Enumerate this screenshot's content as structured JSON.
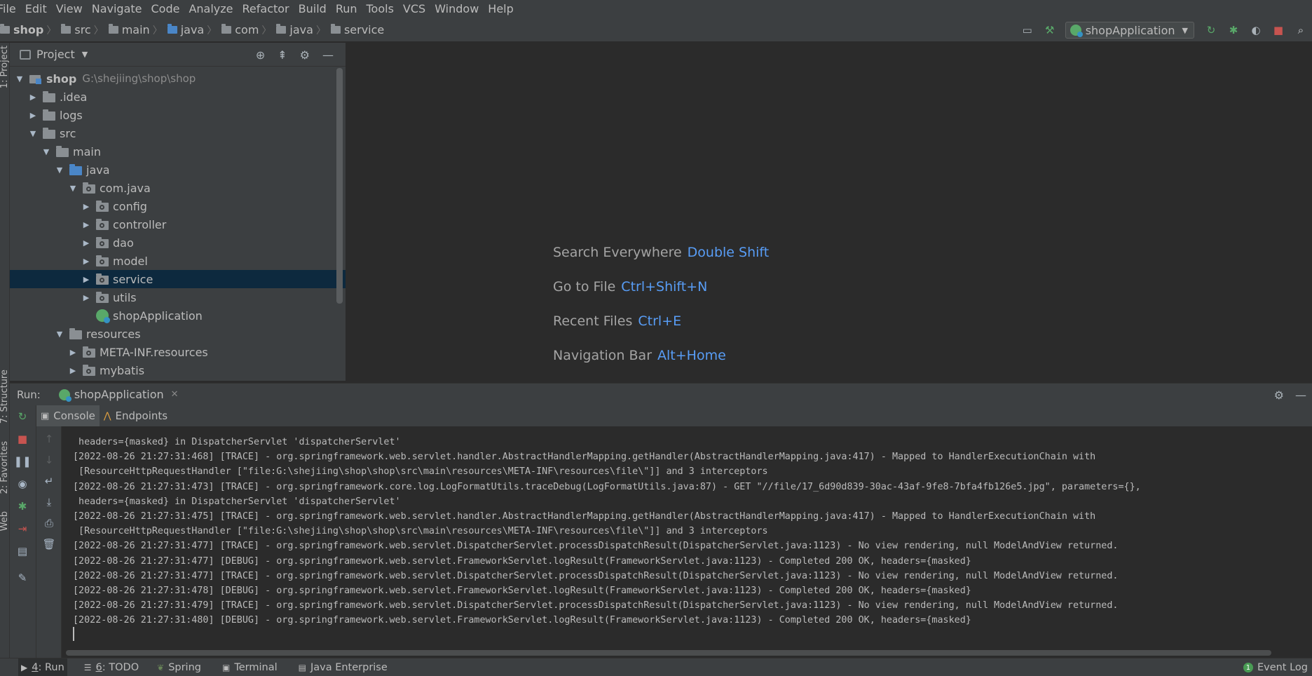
{
  "menu": [
    "File",
    "Edit",
    "View",
    "Navigate",
    "Code",
    "Analyze",
    "Refactor",
    "Build",
    "Run",
    "Tools",
    "VCS",
    "Window",
    "Help"
  ],
  "breadcrumb": [
    "shop",
    "src",
    "main",
    "java",
    "com",
    "java",
    "service"
  ],
  "run_config": "shopApplication",
  "project_panel": {
    "title": "Project",
    "stripe_labels": [
      "1: Project",
      "7: Structure",
      "2: Favorites",
      "Web"
    ],
    "tree": [
      {
        "label": "shop",
        "path": "G:\\shejiing\\shop\\shop",
        "depth": 0,
        "arrow": "open",
        "icon": "module",
        "bold": true
      },
      {
        "label": ".idea",
        "depth": 1,
        "arrow": "closed",
        "icon": "folder"
      },
      {
        "label": "logs",
        "depth": 1,
        "arrow": "closed",
        "icon": "folder"
      },
      {
        "label": "src",
        "depth": 1,
        "arrow": "open",
        "icon": "folder"
      },
      {
        "label": "main",
        "depth": 2,
        "arrow": "open",
        "icon": "folder"
      },
      {
        "label": "java",
        "depth": 3,
        "arrow": "open",
        "icon": "folder-blue"
      },
      {
        "label": "com.java",
        "depth": 4,
        "arrow": "open",
        "icon": "package"
      },
      {
        "label": "config",
        "depth": 5,
        "arrow": "closed",
        "icon": "package"
      },
      {
        "label": "controller",
        "depth": 5,
        "arrow": "closed",
        "icon": "package"
      },
      {
        "label": "dao",
        "depth": 5,
        "arrow": "closed",
        "icon": "package"
      },
      {
        "label": "model",
        "depth": 5,
        "arrow": "closed",
        "icon": "package"
      },
      {
        "label": "service",
        "depth": 5,
        "arrow": "closed",
        "icon": "package",
        "selected": true
      },
      {
        "label": "utils",
        "depth": 5,
        "arrow": "closed",
        "icon": "package"
      },
      {
        "label": "shopApplication",
        "depth": 5,
        "arrow": "none",
        "icon": "spring-app"
      },
      {
        "label": "resources",
        "depth": 3,
        "arrow": "open",
        "icon": "folder"
      },
      {
        "label": "META-INF.resources",
        "depth": 4,
        "arrow": "closed",
        "icon": "package"
      },
      {
        "label": "mybatis",
        "depth": 4,
        "arrow": "closed",
        "icon": "package"
      }
    ]
  },
  "editor_hints": [
    {
      "label": "Search Everywhere",
      "key": "Double Shift"
    },
    {
      "label": "Go to File",
      "key": "Ctrl+Shift+N"
    },
    {
      "label": "Recent Files",
      "key": "Ctrl+E"
    },
    {
      "label": "Navigation Bar",
      "key": "Alt+Home"
    }
  ],
  "run_panel": {
    "label": "Run:",
    "tab": "shopApplication",
    "subtabs": [
      "Console",
      "Endpoints"
    ],
    "console_lines": [
      " headers={masked} in DispatcherServlet 'dispatcherServlet'",
      "[2022-08-26 21:27:31:468] [TRACE] - org.springframework.web.servlet.handler.AbstractHandlerMapping.getHandler(AbstractHandlerMapping.java:417) - Mapped to HandlerExecutionChain with",
      " [ResourceHttpRequestHandler [\"file:G:\\shejiing\\shop\\shop\\src\\main\\resources\\META-INF\\resources\\file\\\"]] and 3 interceptors",
      "[2022-08-26 21:27:31:473] [TRACE] - org.springframework.core.log.LogFormatUtils.traceDebug(LogFormatUtils.java:87) - GET \"//file/17_6d90d839-30ac-43af-9fe8-7bfa4fb126e5.jpg\", parameters={},",
      " headers={masked} in DispatcherServlet 'dispatcherServlet'",
      "[2022-08-26 21:27:31:475] [TRACE] - org.springframework.web.servlet.handler.AbstractHandlerMapping.getHandler(AbstractHandlerMapping.java:417) - Mapped to HandlerExecutionChain with",
      " [ResourceHttpRequestHandler [\"file:G:\\shejiing\\shop\\shop\\src\\main\\resources\\META-INF\\resources\\file\\\"]] and 3 interceptors",
      "[2022-08-26 21:27:31:477] [TRACE] - org.springframework.web.servlet.DispatcherServlet.processDispatchResult(DispatcherServlet.java:1123) - No view rendering, null ModelAndView returned.",
      "[2022-08-26 21:27:31:477] [DEBUG] - org.springframework.web.servlet.FrameworkServlet.logResult(FrameworkServlet.java:1123) - Completed 200 OK, headers={masked}",
      "[2022-08-26 21:27:31:477] [TRACE] - org.springframework.web.servlet.DispatcherServlet.processDispatchResult(DispatcherServlet.java:1123) - No view rendering, null ModelAndView returned.",
      "[2022-08-26 21:27:31:478] [DEBUG] - org.springframework.web.servlet.FrameworkServlet.logResult(FrameworkServlet.java:1123) - Completed 200 OK, headers={masked}",
      "[2022-08-26 21:27:31:479] [TRACE] - org.springframework.web.servlet.DispatcherServlet.processDispatchResult(DispatcherServlet.java:1123) - No view rendering, null ModelAndView returned.",
      "[2022-08-26 21:27:31:480] [DEBUG] - org.springframework.web.servlet.FrameworkServlet.logResult(FrameworkServlet.java:1123) - Completed 200 OK, headers={masked}"
    ]
  },
  "bottom_tools": [
    {
      "num": "4",
      "label": ": Run",
      "active": true
    },
    {
      "num": "6",
      "label": ": TODO"
    },
    {
      "num": "",
      "label": "Spring"
    },
    {
      "num": "",
      "label": "Terminal"
    },
    {
      "num": "",
      "label": "Java Enterprise"
    }
  ],
  "event_log": {
    "badge": "1",
    "label": "Event Log"
  },
  "colors": {
    "accent": "#589df6",
    "selection": "#0d293e",
    "panel": "#3c3f41",
    "editor": "#2b2b2b",
    "run_green": "#59a869",
    "stop_red": "#c75450"
  }
}
